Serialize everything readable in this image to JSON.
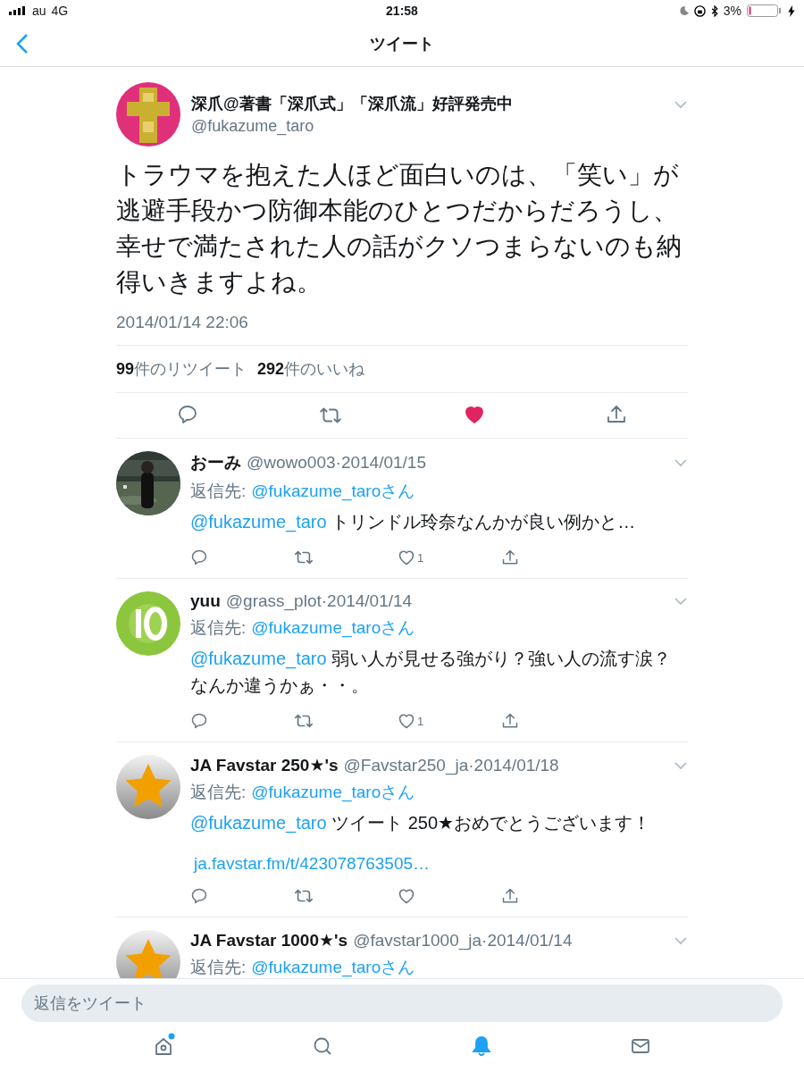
{
  "status_bar": {
    "carrier": "au",
    "network": "4G",
    "time": "21:58",
    "battery": "3%"
  },
  "nav": {
    "title": "ツイート"
  },
  "tweet": {
    "name": "深爪@著書「深爪式」「深爪流」好評発売中",
    "handle": "@fukazume_taro",
    "text": "トラウマを抱えた人ほど面白いのは、「笑い」が逃避手段かつ防御本能のひとつだからだろうし、幸せで満たされた人の話がクソつまらないのも納得いきますよね。",
    "date": "2014/01/14 22:06",
    "retweets_count": "99",
    "retweets_label": "件のリツイート",
    "likes_count": "292",
    "likes_label": "件のいいね",
    "liked": true
  },
  "replies": [
    {
      "name": "おーみ",
      "handle": "@wowo003",
      "date": "·2014/01/15",
      "reply_label": "返信先:",
      "reply_to": "@fukazume_taroさん",
      "mention": "@fukazume_taro",
      "text": "トリンドル玲奈なんかが良い例かと…",
      "like_count": "1",
      "liked": false
    },
    {
      "name": "yuu",
      "handle": "@grass_plot",
      "date": "·2014/01/14",
      "reply_label": "返信先:",
      "reply_to": "@fukazume_taroさん",
      "mention": "@fukazume_taro",
      "text": "弱い人が見せる強がり？強い人の流す涙？なんか違うかぁ・・。",
      "like_count": "1",
      "liked": false
    },
    {
      "name": "JA Favstar 250★'s",
      "handle": "@Favstar250_ja",
      "date": "·2014/01/18",
      "reply_label": "返信先:",
      "reply_to": "@fukazume_taroさん",
      "mention": "@fukazume_taro",
      "text": "ツイート 250★おめでとうございます！",
      "link": "ja.favstar.fm/t/423078763505…",
      "liked": false
    },
    {
      "name": "JA Favstar 1000★'s",
      "handle": "@favstar1000_ja",
      "date": "·2014/01/14",
      "reply_label": "返信先:",
      "reply_to": "@fukazume_taroさん"
    }
  ],
  "reply_box": {
    "placeholder": "返信をツイート"
  },
  "tab_bar": [
    {
      "kind": "home",
      "selected": false,
      "badge": true
    },
    {
      "kind": "search",
      "selected": false,
      "badge": false
    },
    {
      "kind": "notifications",
      "selected": true,
      "badge": false
    },
    {
      "kind": "messages",
      "selected": false,
      "badge": false
    }
  ]
}
